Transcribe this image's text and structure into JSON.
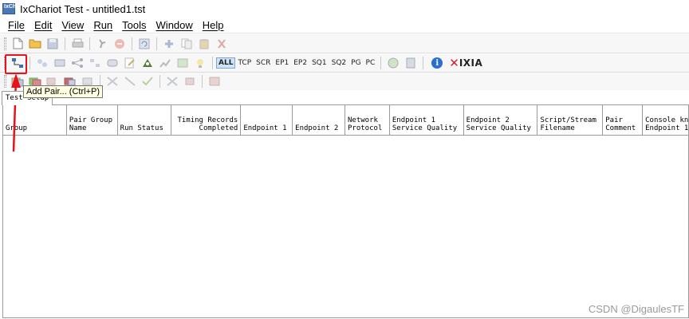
{
  "window": {
    "title": "IxChariot Test - untitled1.tst",
    "icon_text": "IxCh"
  },
  "menu": [
    "File",
    "Edit",
    "View",
    "Run",
    "Tools",
    "Window",
    "Help"
  ],
  "toolbar2_labels": [
    "ALL",
    "TCP",
    "SCR",
    "EP1",
    "EP2",
    "SQ1",
    "SQ2",
    "PG",
    "PC"
  ],
  "brand": {
    "x": "✕",
    "name": "IXIA"
  },
  "tooltip": "Add Pair... (Ctrl+P)",
  "tab_label": "Test Setup",
  "columns": [
    {
      "lines": [
        "Group"
      ]
    },
    {
      "lines": [
        "Pair Group",
        "Name"
      ]
    },
    {
      "lines": [
        "Run Status"
      ]
    },
    {
      "lines": [
        "Timing Records",
        "Completed"
      ]
    },
    {
      "lines": [
        "Endpoint 1"
      ]
    },
    {
      "lines": [
        "Endpoint 2"
      ]
    },
    {
      "lines": [
        "Network",
        "Protocol"
      ]
    },
    {
      "lines": [
        "Endpoint 1",
        "Service Quality"
      ]
    },
    {
      "lines": [
        "Endpoint 2",
        "Service Quality"
      ]
    },
    {
      "lines": [
        "Script/Stream",
        "Filename"
      ]
    },
    {
      "lines": [
        "Pair",
        "Comment"
      ]
    },
    {
      "lines": [
        "Console kn",
        "Endpoint 1"
      ]
    }
  ],
  "watermark": "CSDN @DigaulesTF",
  "colors": {
    "highlight": "#e8121b",
    "brand_red": "#d3232e",
    "info_blue": "#2a6fd0"
  }
}
